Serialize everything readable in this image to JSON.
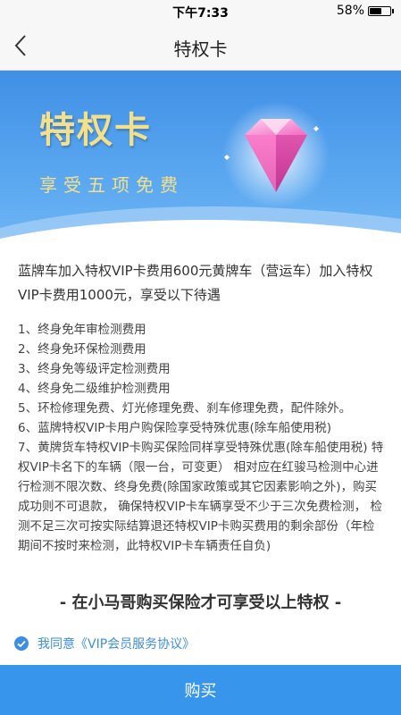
{
  "status": {
    "time": "下午7:33",
    "battery": "58%",
    "battery_level": 0.58
  },
  "nav": {
    "title": "特权卡"
  },
  "banner": {
    "title": "特权卡",
    "subtitle": "享受五项免费"
  },
  "content": {
    "intro": "蓝牌车加入特权VIP卡费用600元黄牌车（营运车）加入特权VIP卡费用1000元，享受以下待遇",
    "benefits": [
      "1、终身免年审检测费用",
      "2、终身免环保检测费用",
      "3、终身免等级评定检测费用",
      "4、终身免二级维护检测费用",
      "5、环检修理免费、灯光修理免费、刹车修理免费，配件除外。",
      "6、蓝牌特权VIP卡用户购保险享受特殊优惠(除车船使用税)",
      "7、黄牌货车特权VIP卡购买保险同样享受特殊优惠(除车船使用税) 特权VIP卡名下的车辆（限一台，可变更） 相对应在红骏马检测中心进行检测不限次数、终身免费(除国家政策或其它因素影响之外)，购买成功则不可退款， 确保特权VIP卡车辆享受不少于三次免费检测， 检测不足三次可按实际结算退还特权VIP卡购买费用的剩余部份（年检期间不按时来检测，此特权VIP卡车辆责任自负)"
    ]
  },
  "notice": "- 在小马哥购买保险才可享受以上特权 -",
  "agreement": {
    "text": "我同意《VIP会员服务协议》",
    "checked": true
  },
  "buy_button": {
    "label": "购买"
  },
  "colors": {
    "primary": "#3895ec",
    "gold": "#f4e08a",
    "link": "#3d8de0"
  }
}
